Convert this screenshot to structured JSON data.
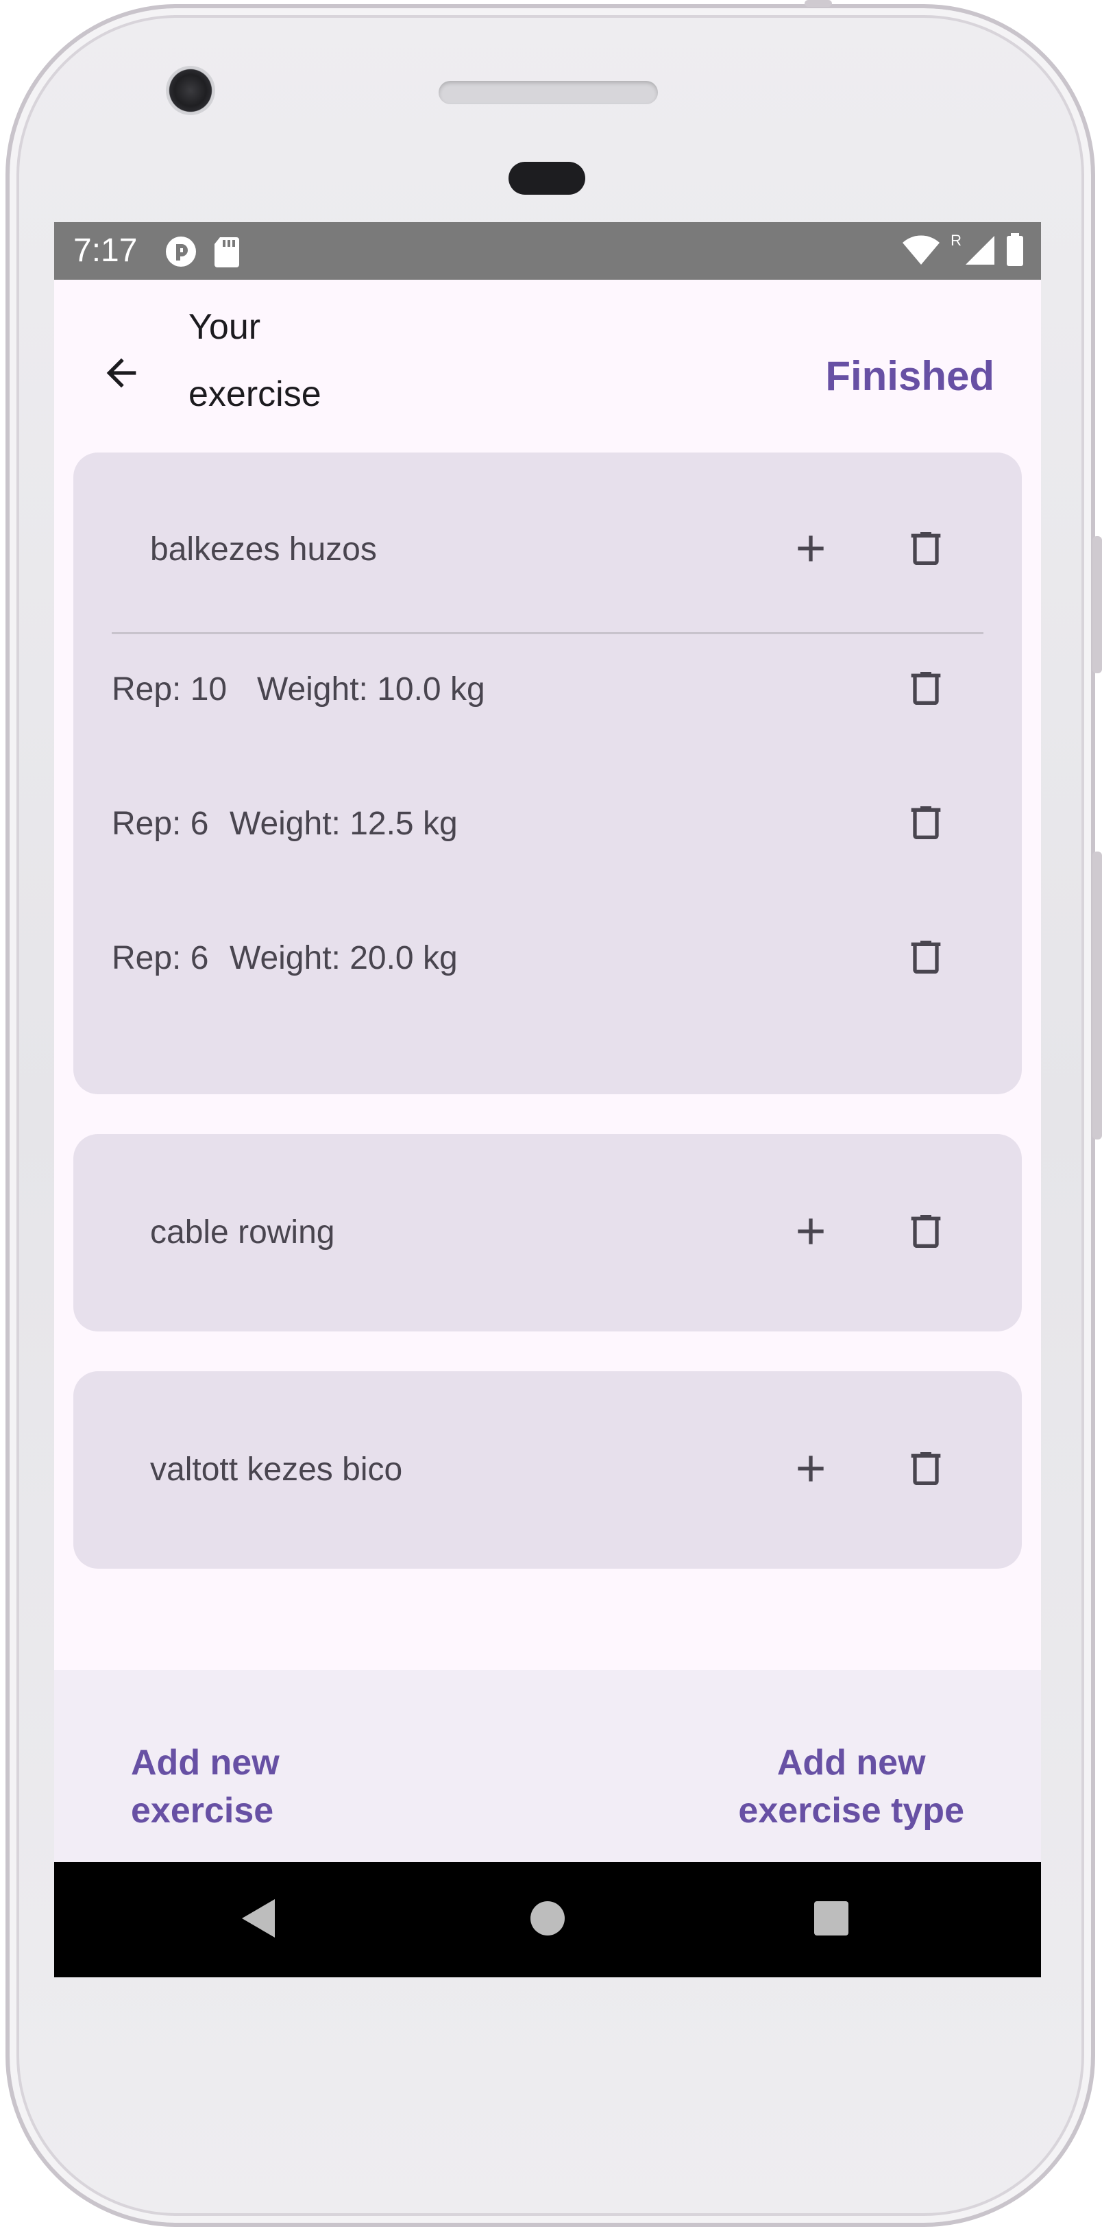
{
  "device": {
    "frame_color": "#e9e8ec"
  },
  "status_bar": {
    "time": "7:17",
    "background": "#7a7a7a",
    "left_icons": [
      "sync-icon",
      "sd-card-icon"
    ],
    "right_icons": [
      "wifi-icon",
      "roaming-label",
      "cell-signal-icon",
      "battery-icon"
    ],
    "roaming_label": "R"
  },
  "app_bar": {
    "title_line1": "Your",
    "title_line2": "exercise",
    "action_label": "Finished",
    "back_icon": "arrow-back-icon"
  },
  "colors": {
    "accent": "#6750a4",
    "card_bg": "#e7e0ec",
    "screen_bg": "#fef7fe",
    "bottom_bar_bg": "#f2edf6",
    "text": "#49454f"
  },
  "exercises": [
    {
      "name": "balkezes huzos",
      "sets": [
        {
          "rep": "Rep: 10",
          "weight": "Weight: 10.0 kg"
        },
        {
          "rep": "Rep: 6",
          "weight": "Weight: 12.5 kg"
        },
        {
          "rep": "Rep: 6",
          "weight": "Weight: 20.0 kg"
        }
      ]
    },
    {
      "name": "cable rowing",
      "sets": []
    },
    {
      "name": "valtott kezes bico",
      "sets": []
    }
  ],
  "bottom_actions": {
    "add_exercise": "Add new\nexercise",
    "add_exercise_type": "Add new\nexercise type"
  },
  "nav": {
    "items": [
      "back-triangle-icon",
      "home-circle-icon",
      "recents-square-icon"
    ]
  }
}
